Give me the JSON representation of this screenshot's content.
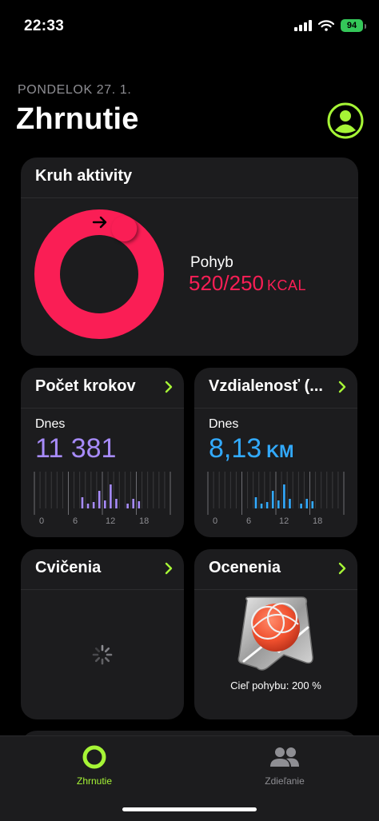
{
  "status": {
    "time": "22:33",
    "battery": "94"
  },
  "header": {
    "date": "PONDELOK 27. 1.",
    "title": "Zhrnutie"
  },
  "activity": {
    "title": "Kruh aktivity",
    "move_label": "Pohyb",
    "move_value": "520/250",
    "move_unit": "KCAL",
    "move_progress_fraction": 2.08,
    "ring_color": "#fa1e55"
  },
  "steps": {
    "title": "Počet krokov",
    "today_label": "Dnes",
    "value": "11 381",
    "color": "#a78bfa",
    "ticks": [
      "0",
      "6",
      "12",
      "18"
    ]
  },
  "distance": {
    "title": "Vzdialenosť (...",
    "today_label": "Dnes",
    "value": "8,13",
    "unit": "KM",
    "color": "#32aaff",
    "ticks": [
      "0",
      "6",
      "12",
      "18"
    ]
  },
  "workouts": {
    "title": "Cvičenia"
  },
  "awards": {
    "title": "Ocenenia",
    "caption": "Cieľ pohybu: 200 %"
  },
  "tabbar": {
    "accent": "#a6f536",
    "items": [
      {
        "label": "Zhrnutie",
        "icon": "activity-ring-icon",
        "active": true
      },
      {
        "label": "Zdieľanie",
        "icon": "people-icon",
        "active": false
      }
    ]
  }
}
